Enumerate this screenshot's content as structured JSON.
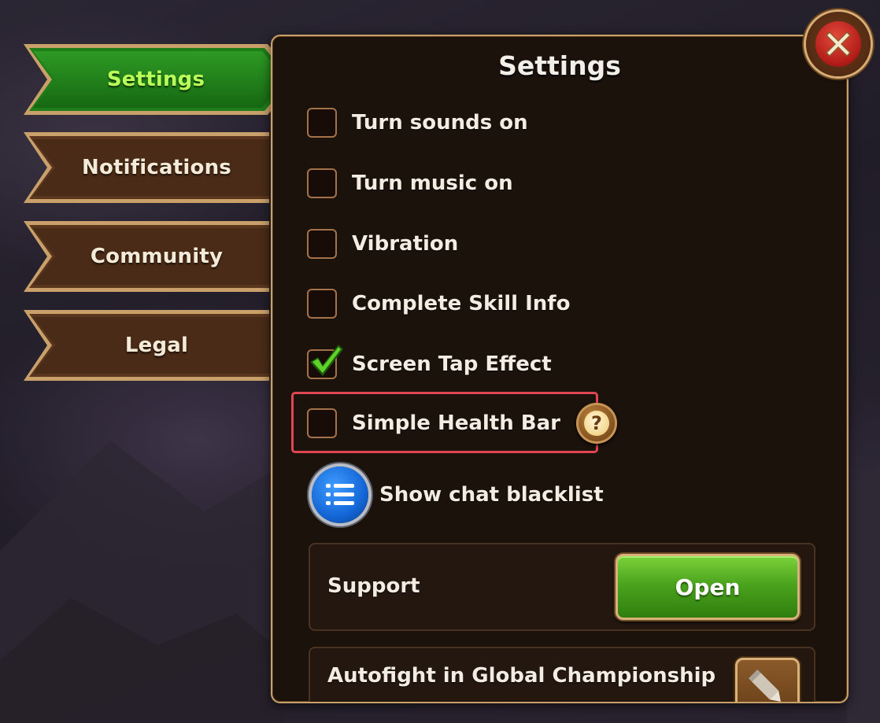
{
  "tabs": [
    {
      "label": "Settings",
      "active": true
    },
    {
      "label": "Notifications",
      "active": false
    },
    {
      "label": "Community",
      "active": false
    },
    {
      "label": "Legal",
      "active": false
    }
  ],
  "panel": {
    "title": "Settings",
    "options": [
      {
        "label": "Turn sounds on",
        "checked": false
      },
      {
        "label": "Turn music on",
        "checked": false
      },
      {
        "label": "Vibration",
        "checked": false
      },
      {
        "label": "Complete Skill Info",
        "checked": false
      },
      {
        "label": "Screen Tap Effect",
        "checked": true
      },
      {
        "label": "Simple Health Bar",
        "checked": false,
        "has_help": true,
        "highlighted": true
      }
    ],
    "help_symbol": "?",
    "chat_blacklist": {
      "label": "Show chat blacklist",
      "icon": "list-icon"
    },
    "support": {
      "label": "Support",
      "button_label": "Open"
    },
    "autofight": {
      "label": "Autofight in Global Championship",
      "icon": "pencil-icon"
    }
  },
  "colors": {
    "active_tab": "#1f7d1a",
    "active_tab_text": "#b9ff5a",
    "highlight_border": "#e04552",
    "open_button": "#4ba41d"
  },
  "close_icon": "close-icon"
}
